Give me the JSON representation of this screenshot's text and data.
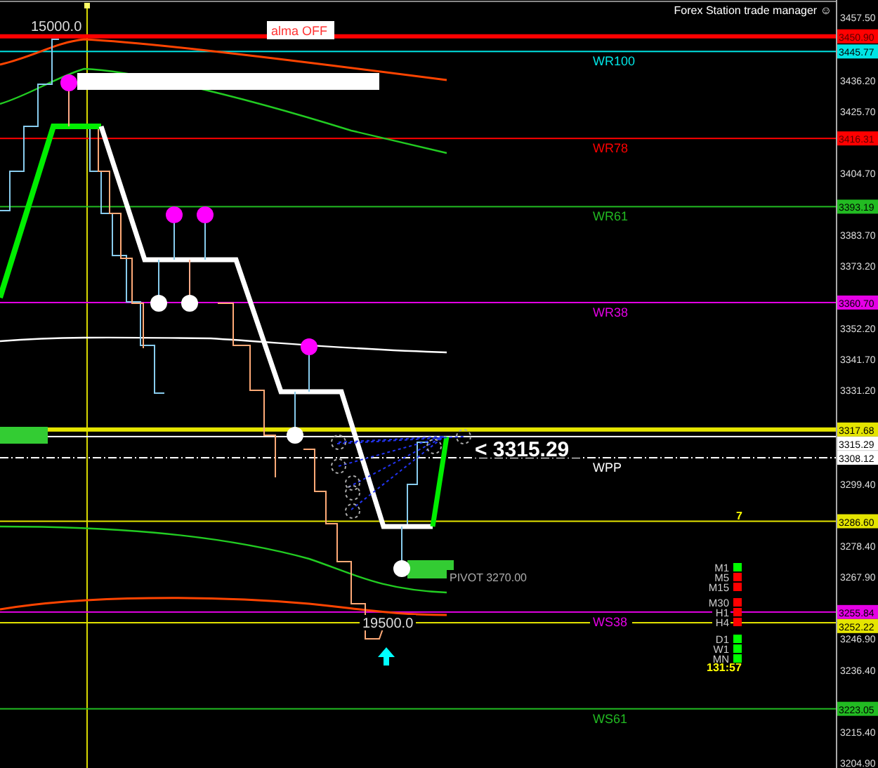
{
  "header": {
    "title": "Forex Station trade manager ☺"
  },
  "chart_labels": {
    "high_value": "15000.0",
    "alma_status": "alma OFF",
    "current_price": "< 3315.29",
    "pivot": "PIVOT 3270.00",
    "low_value": "19500.0"
  },
  "price_axis": {
    "ticks": [
      "3457.50",
      "3436.20",
      "3425.70",
      "3404.70",
      "3383.70",
      "3373.20",
      "3352.20",
      "3341.70",
      "3331.20",
      "3299.40",
      "3278.40",
      "3267.90",
      "3246.90",
      "3236.40",
      "3215.40",
      "3204.90"
    ]
  },
  "levels": [
    {
      "price": "3450.90",
      "color": "#ff0000",
      "kind": "thick"
    },
    {
      "price": "3445.77",
      "label": "WR100",
      "color": "#00e5e5",
      "kind": "thin"
    },
    {
      "price": "3416.31",
      "label": "WR78",
      "color": "#ff0000",
      "kind": "thin"
    },
    {
      "price": "3393.19",
      "label": "WR61",
      "color": "#22bb22",
      "kind": "thin"
    },
    {
      "price": "3360.70",
      "label": "WR38",
      "color": "#e600e6",
      "kind": "thin"
    },
    {
      "price": "3317.68",
      "color": "#e5e500",
      "kind": "thick"
    },
    {
      "price": "3315.29",
      "color": "#ffffff",
      "kind": "thin"
    },
    {
      "price": "3308.12",
      "label": "WPP",
      "color": "#ffffff",
      "kind": "dashdot"
    },
    {
      "price": "3286.60",
      "color": "#e5e500",
      "kind": "thin"
    },
    {
      "price": "3255.84",
      "label": "WS38",
      "color": "#e600e6",
      "kind": "thin"
    },
    {
      "price": "3252.22",
      "color": "#e5e500",
      "kind": "thin"
    },
    {
      "price": "3223.05",
      "label": "WS61",
      "color": "#22bb22",
      "kind": "thin"
    }
  ],
  "timeframes": {
    "count": "7",
    "timer": "131:57",
    "items": [
      {
        "label": "M1",
        "color": "#00ff00"
      },
      {
        "label": "M5",
        "color": "#ff0000"
      },
      {
        "label": "M15",
        "color": "#ff0000"
      },
      {
        "label": "M30",
        "color": "#ff0000"
      },
      {
        "label": "H1",
        "color": "#ff0000"
      },
      {
        "label": "H4",
        "color": "#ff0000"
      },
      {
        "label": "D1",
        "color": "#00ff00"
      },
      {
        "label": "W1",
        "color": "#00ff00"
      },
      {
        "label": "MN",
        "color": "#00ff00"
      }
    ]
  }
}
